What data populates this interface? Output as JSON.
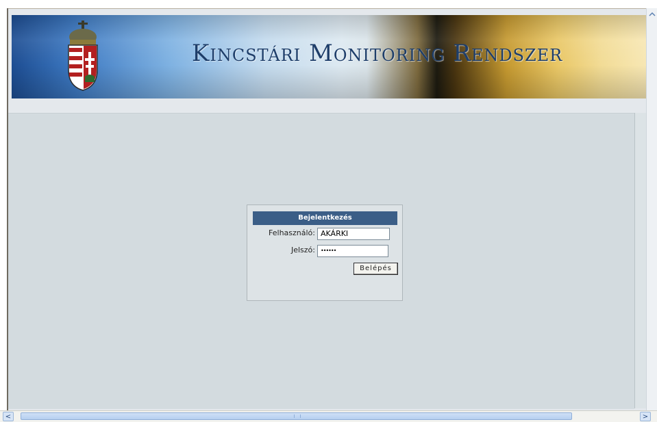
{
  "banner": {
    "title": "Kincstári Monitoring Rendszer",
    "crest_icon": "hungarian-coat-of-arms"
  },
  "login": {
    "header": "Bejelentkezés",
    "username_label": "Felhasználó:",
    "username_value": "AKÁRKI",
    "password_label": "Jelszó:",
    "password_value": "••••••",
    "submit_label": "Belépés"
  },
  "scrollbar": {
    "left_arrow": "<",
    "right_arrow": ">"
  },
  "colors": {
    "login_header": "#3b5e87",
    "content_bg": "#d3dbdf",
    "title_text": "#1e3e6a"
  }
}
